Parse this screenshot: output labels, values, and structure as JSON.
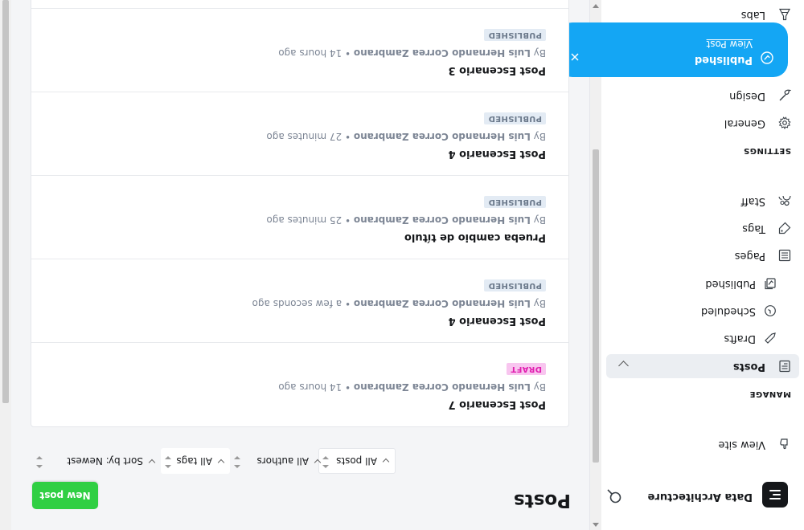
{
  "brand": {
    "name": "Data Architecture",
    "logo_icon": "ghost-logo-icon",
    "search_icon": "search-icon"
  },
  "nav": {
    "view_site": "View site",
    "manage_heading": "MANAGE",
    "posts": "Posts",
    "drafts": "Drafts",
    "scheduled": "Scheduled",
    "published": "Published",
    "pages": "Pages",
    "tags": "Tags",
    "staff": "Staff",
    "settings_heading": "SETTINGS",
    "general": "General",
    "design": "Design",
    "labs": "Labs"
  },
  "toast": {
    "title": "Published",
    "link": "View Post",
    "color": "#14a6f4"
  },
  "main": {
    "title": "Posts",
    "new_post": "New post",
    "filters": {
      "type": "All posts",
      "authors": "All authors",
      "tags": "All tags",
      "sort": "Sort by: Newest"
    }
  },
  "posts": [
    {
      "title": "Post Escenario 7",
      "author": "Luis Hernando Correa Zambrano",
      "time": "14 hours ago",
      "status": "DRAFT"
    },
    {
      "title": "Post Escenario 4",
      "author": "Luis Hernando Correa Zambrano",
      "time": "a few seconds ago",
      "status": "PUBLISHED"
    },
    {
      "title": "Prueba cambio de título",
      "author": "Luis Hernando Correa Zambrano",
      "time": "25 minutes ago",
      "status": "PUBLISHED"
    },
    {
      "title": "Post Escenario 4",
      "author": "Luis Hernando Correa Zambrano",
      "time": "27 minutes ago",
      "status": "PUBLISHED"
    },
    {
      "title": "Post Escenario 3",
      "author": "Luis Hernando Correa Zambrano",
      "time": "14 hours ago",
      "status": "PUBLISHED"
    }
  ],
  "labels": {
    "by": "By",
    "sep": "•"
  },
  "colors": {
    "accent_green": "#30cf43",
    "draft_pink": "#e11fb0",
    "toast_blue": "#14a6f4"
  }
}
